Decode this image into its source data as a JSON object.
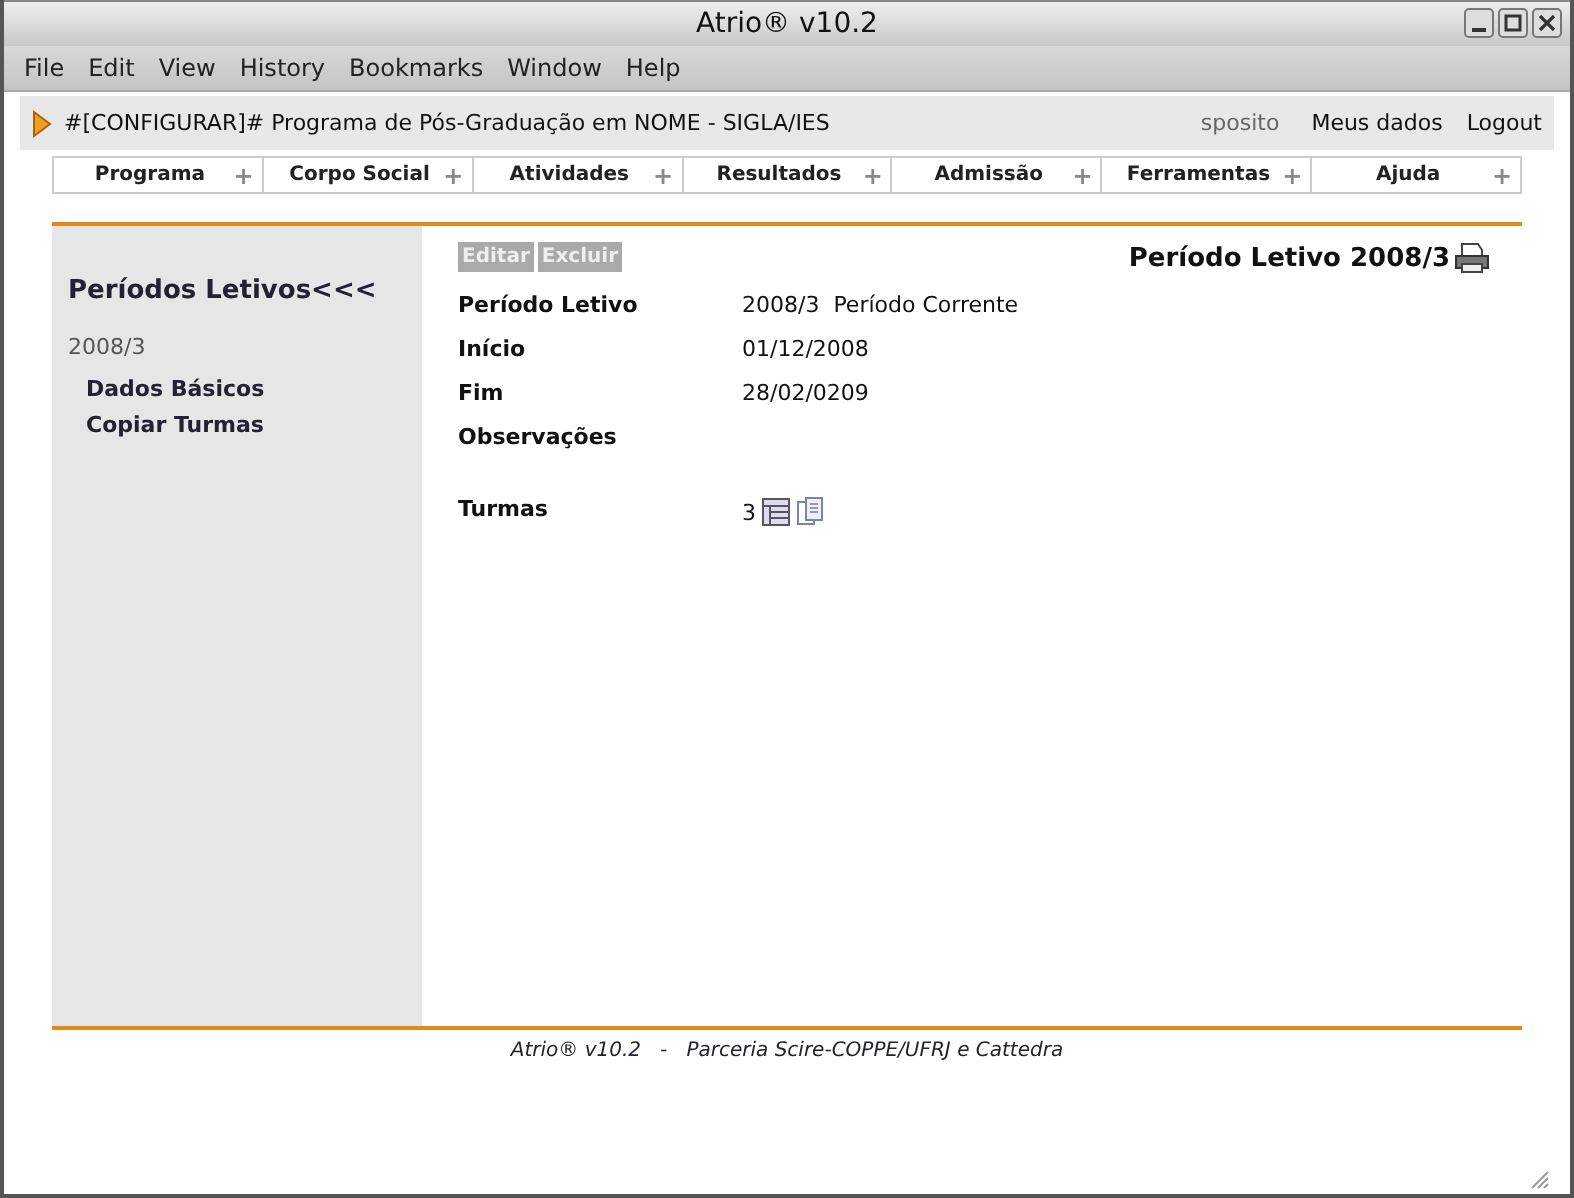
{
  "window": {
    "title": "Atrio® v10.2"
  },
  "menu": [
    "File",
    "Edit",
    "View",
    "History",
    "Bookmarks",
    "Window",
    "Help"
  ],
  "header": {
    "title": "#[CONFIGURAR]# Programa de Pós-Graduação em NOME - SIGLA/IES",
    "user": "sposito",
    "links": [
      "Meus dados",
      "Logout"
    ]
  },
  "nav": [
    {
      "label": "Programa",
      "expander": "+"
    },
    {
      "label": "Corpo Social",
      "expander": "+"
    },
    {
      "label": "Atividades",
      "expander": "+"
    },
    {
      "label": "Resultados",
      "expander": "+"
    },
    {
      "label": "Admissão",
      "expander": "+"
    },
    {
      "label": "Ferramentas",
      "expander": "+"
    },
    {
      "label": "Ajuda",
      "expander": "+"
    }
  ],
  "sidebar": {
    "title": "Períodos Letivos<<<",
    "section": "2008/3",
    "items": [
      "Dados Básicos",
      "Copiar Turmas"
    ]
  },
  "actions": [
    {
      "label": "Editar",
      "disabled": true
    },
    {
      "label": "Excluir",
      "disabled": true
    }
  ],
  "page_title": "Período Letivo 2008/3",
  "fields": [
    {
      "label": "Período Letivo",
      "value": "2008/3  Período Corrente"
    },
    {
      "label": "Início",
      "value": "01/12/2008"
    },
    {
      "label": "Fim",
      "value": "28/02/0209"
    },
    {
      "label": "Observações"
    },
    {
      "label": "Turmas",
      "value": "3",
      "kind": "count"
    }
  ],
  "footer": "Atrio® v10.2   -   Parceria Scire-COPPE/UFRJ e Cattedra"
}
